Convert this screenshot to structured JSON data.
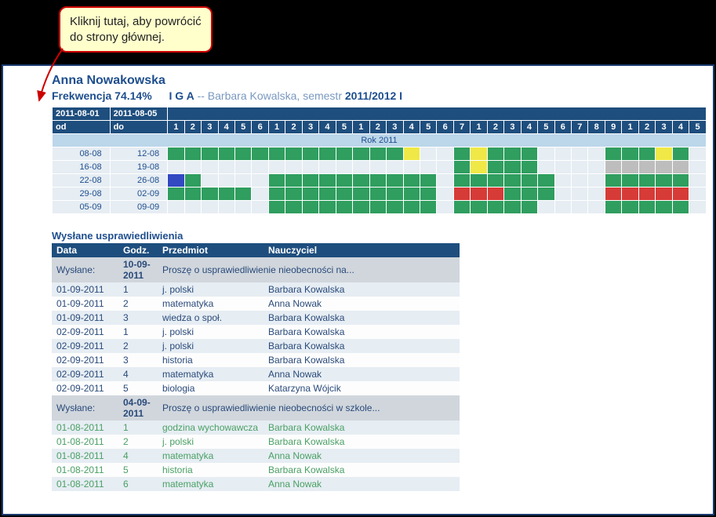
{
  "tooltip": {
    "line1": "Kliknij tutaj, aby powrócić",
    "line2": "do strony głównej."
  },
  "header": {
    "student": "Anna Nowakowska",
    "freq_label": "Frekwencja",
    "freq_pct": "74.14%",
    "class": "I G A",
    "sep": "--",
    "teacher": "Barbara Kowalska, semestr",
    "sem": "2011/2012 I"
  },
  "att_header": {
    "from_date": "2011-08-01",
    "to_date": "2011-08-05",
    "from": "od",
    "to": "do",
    "year": "Rok 2011"
  },
  "days": [
    [
      "1",
      "2",
      "3",
      "4",
      "5",
      "6"
    ],
    [
      "1",
      "2",
      "3",
      "4",
      "5"
    ],
    [
      "1",
      "2",
      "3",
      "4",
      "5",
      "6",
      "7"
    ],
    [
      "1",
      "2",
      "3",
      "4",
      "5",
      "6",
      "7",
      "8",
      "9"
    ],
    [
      "1",
      "2",
      "3",
      "4",
      "5"
    ]
  ],
  "rows": [
    {
      "od": "08-08",
      "do": "12-08",
      "cells": [
        "g",
        "g",
        "g",
        "g",
        "g",
        "g",
        "g",
        "g",
        "g",
        "g",
        "g",
        "g",
        "g",
        "g",
        "y",
        "e",
        "e",
        "g",
        "y",
        "g",
        "g",
        "g",
        "e",
        "e",
        "e",
        "e",
        "g",
        "g",
        "g",
        "y",
        "g"
      ]
    },
    {
      "od": "16-08",
      "do": "19-08",
      "cells": [
        "e",
        "e",
        "e",
        "e",
        "e",
        "e",
        "e",
        "e",
        "e",
        "e",
        "e",
        "e",
        "e",
        "e",
        "e",
        "e",
        "e",
        "g",
        "y",
        "g",
        "g",
        "g",
        "e",
        "e",
        "e",
        "e",
        "gr",
        "gr",
        "gr",
        "gr",
        "gr"
      ]
    },
    {
      "od": "22-08",
      "do": "26-08",
      "cells": [
        "b",
        "g",
        "e",
        "e",
        "e",
        "e",
        "g",
        "g",
        "g",
        "g",
        "g",
        "g",
        "g",
        "g",
        "g",
        "g",
        "e",
        "g",
        "g",
        "g",
        "g",
        "g",
        "g",
        "e",
        "e",
        "e",
        "g",
        "g",
        "g",
        "g",
        "g"
      ]
    },
    {
      "od": "29-08",
      "do": "02-09",
      "cells": [
        "g",
        "g",
        "g",
        "g",
        "g",
        "e",
        "g",
        "g",
        "g",
        "g",
        "g",
        "g",
        "g",
        "g",
        "g",
        "g",
        "e",
        "r",
        "r",
        "r",
        "g",
        "g",
        "g",
        "e",
        "e",
        "e",
        "r",
        "r",
        "r",
        "r",
        "r"
      ]
    },
    {
      "od": "05-09",
      "do": "09-09",
      "cells": [
        "e",
        "e",
        "e",
        "e",
        "e",
        "e",
        "g",
        "g",
        "g",
        "g",
        "g",
        "g",
        "g",
        "g",
        "g",
        "g",
        "e",
        "g",
        "g",
        "g",
        "g",
        "g",
        "e",
        "e",
        "e",
        "e",
        "g",
        "g",
        "g",
        "g",
        "g"
      ]
    }
  ],
  "justif_title": "Wysłane usprawiedliwienia",
  "justif_headers": {
    "data": "Data",
    "godz": "Godz.",
    "przedmiot": "Przedmiot",
    "nauczyciel": "Nauczyciel"
  },
  "sent1": {
    "label": "Wysłane:",
    "date": "10-09-2011",
    "text": "Proszę o usprawiedliwienie nieobecności na..."
  },
  "sent2": {
    "label": "Wysłane:",
    "date": "04-09-2011",
    "text": "Proszę o usprawiedliwienie nieobecności w szkole..."
  },
  "justif1": [
    {
      "d": "01-09-2011",
      "g": "1",
      "p": "j. polski",
      "n": "Barbara Kowalska"
    },
    {
      "d": "01-09-2011",
      "g": "2",
      "p": "matematyka",
      "n": "Anna Nowak"
    },
    {
      "d": "01-09-2011",
      "g": "3",
      "p": "wiedza o społ.",
      "n": "Barbara Kowalska"
    },
    {
      "d": "02-09-2011",
      "g": "1",
      "p": "j. polski",
      "n": "Barbara Kowalska"
    },
    {
      "d": "02-09-2011",
      "g": "2",
      "p": "j. polski",
      "n": "Barbara Kowalska"
    },
    {
      "d": "02-09-2011",
      "g": "3",
      "p": "historia",
      "n": "Barbara Kowalska"
    },
    {
      "d": "02-09-2011",
      "g": "4",
      "p": "matematyka",
      "n": "Anna Nowak"
    },
    {
      "d": "02-09-2011",
      "g": "5",
      "p": "biologia",
      "n": "Katarzyna Wójcik"
    }
  ],
  "justif2": [
    {
      "d": "01-08-2011",
      "g": "1",
      "p": "godzina wychowawcza",
      "n": "Barbara Kowalska"
    },
    {
      "d": "01-08-2011",
      "g": "2",
      "p": "j. polski",
      "n": "Barbara Kowalska"
    },
    {
      "d": "01-08-2011",
      "g": "4",
      "p": "matematyka",
      "n": "Anna Nowak"
    },
    {
      "d": "01-08-2011",
      "g": "5",
      "p": "historia",
      "n": "Barbara Kowalska"
    },
    {
      "d": "01-08-2011",
      "g": "6",
      "p": "matematyka",
      "n": "Anna Nowak"
    }
  ]
}
